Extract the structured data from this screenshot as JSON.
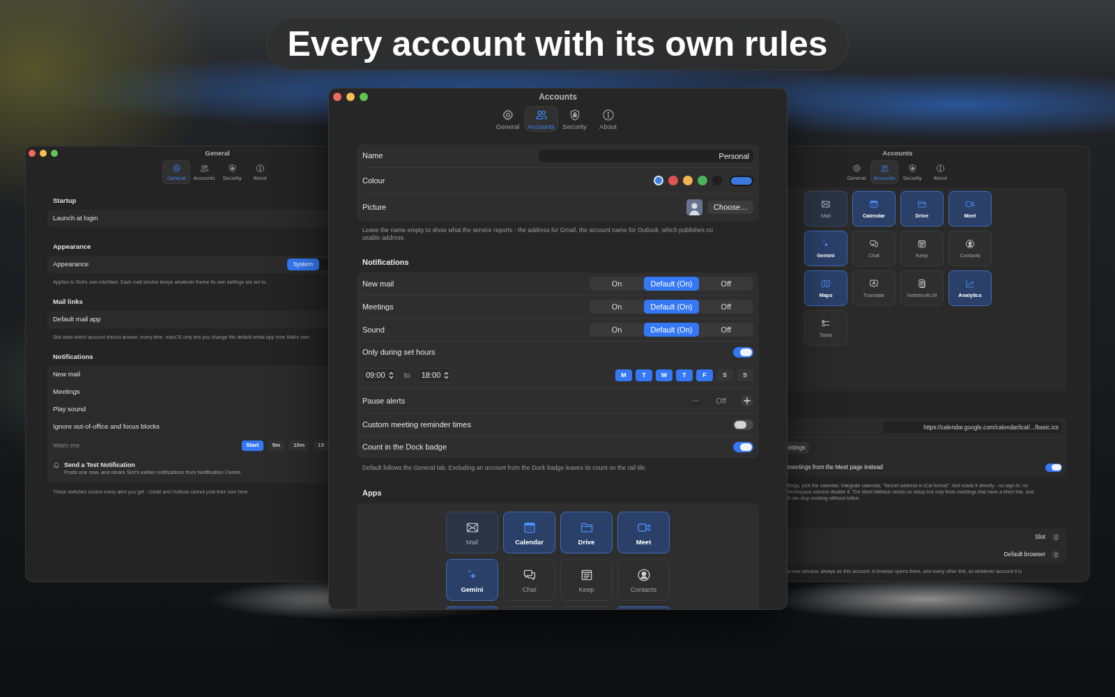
{
  "banner": {
    "title": "Every account with its own rules"
  },
  "general_window": {
    "title": "General",
    "tabs": [
      {
        "label": "General",
        "selected": true
      },
      {
        "label": "Accounts",
        "selected": false
      },
      {
        "label": "Security",
        "selected": false
      },
      {
        "label": "About",
        "selected": false
      }
    ],
    "sections": [
      {
        "heading": "Startup",
        "rows": [
          {
            "kind": "plain",
            "label": "Launch at login",
            "disabled": false
          }
        ]
      },
      {
        "heading": "Appearance",
        "rows": [
          {
            "kind": "segmented",
            "label": "Appearance",
            "disabled": false,
            "options": [
              {
                "label": "System",
                "selected": true
              }
            ]
          }
        ],
        "note": "Applies to Slot's own interface. Each mail service keeps whatever theme its own settings are set to."
      },
      {
        "heading": "Mail links",
        "rows": [
          {
            "kind": "plain",
            "label": "Default mail app",
            "disabled": false
          }
        ],
        "note": "Slot asks which account should answer, every time. macOS only lets you change the default email app from Mail's own"
      },
      {
        "heading": "Notifications",
        "rows": [
          {
            "kind": "plain",
            "label": "New mail",
            "disabled": false
          },
          {
            "kind": "plain",
            "label": "Meetings",
            "disabled": false
          },
          {
            "kind": "plain",
            "label": "Play sound",
            "disabled": false
          },
          {
            "kind": "plain",
            "label": "Ignore out-of-office and focus blocks",
            "disabled": false
          },
          {
            "kind": "chips",
            "label": "Warn me",
            "disabled": true,
            "options": [
              {
                "label": "Start",
                "selected": true
              },
              {
                "label": "5m",
                "selected": false
              },
              {
                "label": "10m",
                "selected": false
              },
              {
                "label": "15",
                "selected": false
              }
            ]
          },
          {
            "kind": "action",
            "label": "Send a Test Notification",
            "disabled": false,
            "description": "Posts one now, and clears Slot's earlier notifications from Notification Centre."
          }
        ],
        "note": "These switches control every alert you get - Gmail and Outlook cannot post their own here."
      }
    ]
  },
  "accounts_window": {
    "title": "Accounts",
    "tabs": [
      {
        "label": "General",
        "selected": false
      },
      {
        "label": "Accounts",
        "selected": true
      },
      {
        "label": "Security",
        "selected": false
      },
      {
        "label": "About",
        "selected": false
      }
    ],
    "profile": {
      "rows": [
        {
          "kind": "text_field",
          "label": "Name",
          "value": "Personal"
        },
        {
          "kind": "colour",
          "label": "Colour",
          "swatches": [
            {
              "color": "#3d7fe6",
              "selected": true
            },
            {
              "color": "#de5252",
              "selected": false
            },
            {
              "color": "#f2b350",
              "selected": false
            },
            {
              "color": "#4cb25c",
              "selected": false
            },
            {
              "color": "#1e1e1e",
              "selected": false
            }
          ],
          "custom": {
            "color": "#3a78dc"
          }
        },
        {
          "kind": "picture",
          "label": "Picture",
          "button": "Choose…"
        }
      ],
      "note": "Leave the name empty to show what the service reports - the address for Gmail, the account name for Outlook, which publishes no usable address."
    },
    "notifications": {
      "heading": "Notifications",
      "rows": [
        {
          "kind": "segmented",
          "label": "New mail",
          "options": [
            {
              "label": "On",
              "selected": false
            },
            {
              "label": "Default (On)",
              "selected": true
            },
            {
              "label": "Off",
              "selected": false
            }
          ]
        },
        {
          "kind": "segmented",
          "label": "Meetings",
          "options": [
            {
              "label": "On",
              "selected": false
            },
            {
              "label": "Default (On)",
              "selected": true
            },
            {
              "label": "Off",
              "selected": false
            }
          ]
        },
        {
          "kind": "segmented",
          "label": "Sound",
          "options": [
            {
              "label": "On",
              "selected": false
            },
            {
              "label": "Default (On)",
              "selected": true
            },
            {
              "label": "Off",
              "selected": false
            }
          ]
        },
        {
          "kind": "toggle",
          "label": "Only during set hours",
          "on": true
        },
        {
          "kind": "schedule",
          "from": "09:00",
          "separator": "to",
          "to": "18:00",
          "days": [
            {
              "label": "M",
              "selected": true
            },
            {
              "label": "T",
              "selected": true
            },
            {
              "label": "W",
              "selected": true
            },
            {
              "label": "T",
              "selected": true
            },
            {
              "label": "F",
              "selected": true
            },
            {
              "label": "S",
              "selected": false
            },
            {
              "label": "S",
              "selected": false
            }
          ]
        },
        {
          "kind": "stepper",
          "label": "Pause alerts",
          "value": "Off",
          "minus_disabled": true
        },
        {
          "kind": "toggle",
          "label": "Custom meeting reminder times",
          "on": false
        },
        {
          "kind": "toggle",
          "label": "Count in the Dock badge",
          "on": true
        }
      ],
      "note": "Default follows the General tab. Excluding an account from the Dock badge leaves its count on the rail tile."
    },
    "apps": {
      "heading": "Apps",
      "tiles": [
        {
          "label": "Mail",
          "selected": true,
          "disabled": true
        },
        {
          "label": "Calendar",
          "selected": true,
          "disabled": false
        },
        {
          "label": "Drive",
          "selected": true,
          "disabled": false
        },
        {
          "label": "Meet",
          "selected": true,
          "disabled": false
        },
        {
          "label": "Gemini",
          "selected": true,
          "disabled": false
        },
        {
          "label": "Chat",
          "selected": false,
          "disabled": false
        },
        {
          "label": "Keep",
          "selected": false,
          "disabled": false
        },
        {
          "label": "Contacts",
          "selected": false,
          "disabled": false
        },
        {
          "selected": true
        },
        {
          "selected": false
        },
        {
          "selected": false
        },
        {
          "selected": true
        }
      ]
    }
  },
  "second_accounts_window": {
    "title": "Accounts",
    "tabs": [
      {
        "label": "General",
        "selected": false
      },
      {
        "label": "Accounts",
        "selected": true
      },
      {
        "label": "Security",
        "selected": false
      },
      {
        "label": "About",
        "selected": false
      }
    ],
    "tiles": [
      {
        "label": "Mail",
        "selected": true,
        "disabled": true
      },
      {
        "label": "Calendar",
        "selected": true,
        "disabled": false
      },
      {
        "label": "Drive",
        "selected": true,
        "disabled": false
      },
      {
        "label": "Meet",
        "selected": true,
        "disabled": false
      },
      {
        "label": "Gemini",
        "selected": true,
        "disabled": false
      },
      {
        "label": "Chat",
        "selected": false,
        "disabled": false
      },
      {
        "label": "Keep",
        "selected": false,
        "disabled": false
      },
      {
        "label": "Contacts",
        "selected": false,
        "disabled": false
      },
      {
        "label": "Maps",
        "selected": true,
        "disabled": false
      },
      {
        "label": "Translate",
        "selected": false,
        "disabled": false
      },
      {
        "label": "NotebookLM",
        "selected": false,
        "disabled": false
      },
      {
        "label": "Analytics",
        "selected": true,
        "disabled": false
      },
      {
        "label": "Tasks",
        "selected": false,
        "disabled": false
      }
    ],
    "calendar": {
      "url": "https://calendar.google.com/calendar/ical/.../basic.ics",
      "button": "ettings",
      "toggle_label": "meetings from the Meet page instead",
      "toggle_on": true,
      "note": "ttings, pick the calendar, Integrate calendar, “Secret address in iCal format”. Slot reads it directly - no sign-in, no\nWorkspace admins disable it. The Meet fallback needs no setup but only finds meetings that have a Meet link, and\nit can stop working without notice."
    },
    "links": {
      "rows": [
        {
          "value": "Slot"
        },
        {
          "value": "Default browser"
        }
      ],
      "note": "a new window, always as this account. A browser opens them, and every other link, as whatever account it is"
    }
  }
}
